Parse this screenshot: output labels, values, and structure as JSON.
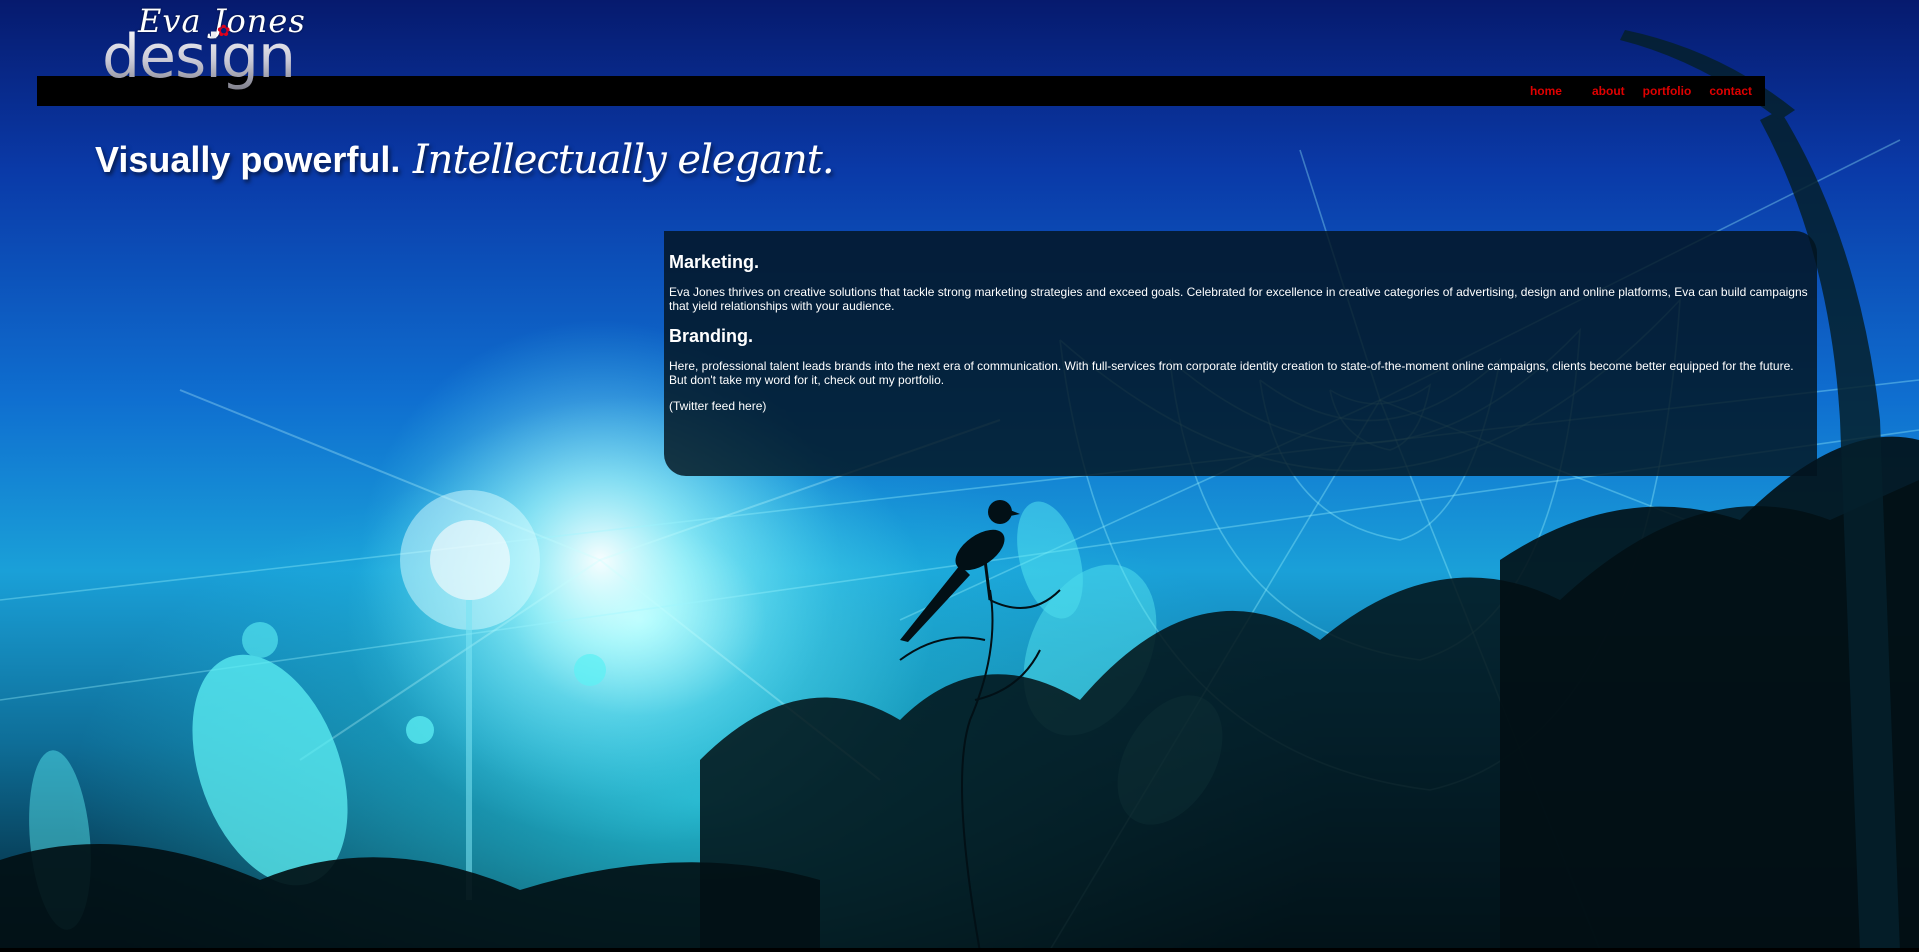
{
  "logo": {
    "script_text": "Eva Jones",
    "main_text": "design",
    "flower_glyph": "✿",
    "flower_color": "#e0001a"
  },
  "nav": {
    "items": [
      {
        "label": "home"
      },
      {
        "label": "about"
      },
      {
        "label": "portfolio"
      },
      {
        "label": "contact"
      }
    ],
    "link_color": "#e00000"
  },
  "hero": {
    "tagline_bold": "Visually powerful.",
    "tagline_script": "Intellectually elegant."
  },
  "content": {
    "marketing_heading": "Marketing.",
    "marketing_text": "Eva Jones thrives on creative solutions that tackle strong marketing strategies and exceed goals. Celebrated for excellence in creative categories of advertising, design and online platforms, Eva can build campaigns that yield relationships with your audience.",
    "branding_heading": "Branding.",
    "branding_text": "Here, professional talent leads brands into the next era of communication. With full-services from corporate identity creation to state-of-the-moment online campaigns, clients become better equipped for the future. But don't take my word for it, check out my portfolio.",
    "twitter_placeholder": "(Twitter feed here)"
  },
  "colors": {
    "sky_top": "#061a6e",
    "sky_mid": "#0f6fd0",
    "glow": "#b9ffff",
    "panel_bg": "#02141e",
    "nav_bg": "#000000"
  }
}
